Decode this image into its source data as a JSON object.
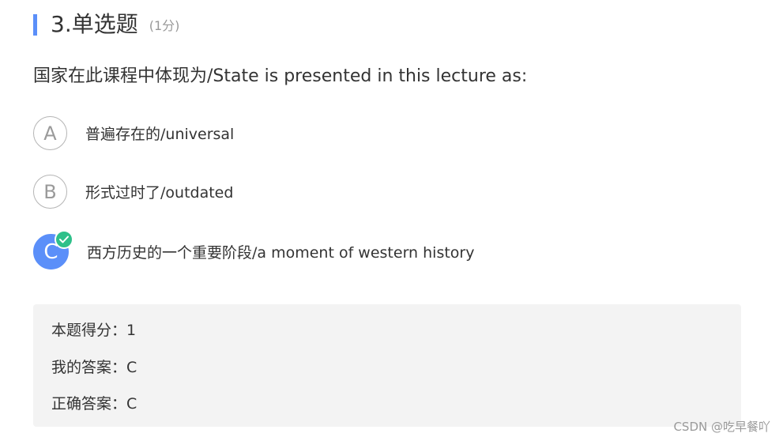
{
  "header": {
    "title": "3.单选题",
    "score": "(1分)"
  },
  "question": {
    "text": "国家在此课程中体现为/State is presented in this lecture as:"
  },
  "options": [
    {
      "letter": "A",
      "text": "普遍存在的/universal",
      "selected": false
    },
    {
      "letter": "B",
      "text": "形式过时了/outdated",
      "selected": false
    },
    {
      "letter": "C",
      "text": "西方历史的一个重要阶段/a moment of western history",
      "selected": true,
      "correct": true
    }
  ],
  "result": {
    "score_line": "本题得分：1",
    "my_answer_line": "我的答案：C",
    "correct_answer_line": "正确答案：C"
  },
  "watermark": "CSDN @吃早餐吖",
  "colors": {
    "accent": "#5b8ff9",
    "correct": "#2ec08a",
    "result_bg": "#f3f3f3"
  },
  "icons": {
    "correct": "check-circle-icon"
  }
}
